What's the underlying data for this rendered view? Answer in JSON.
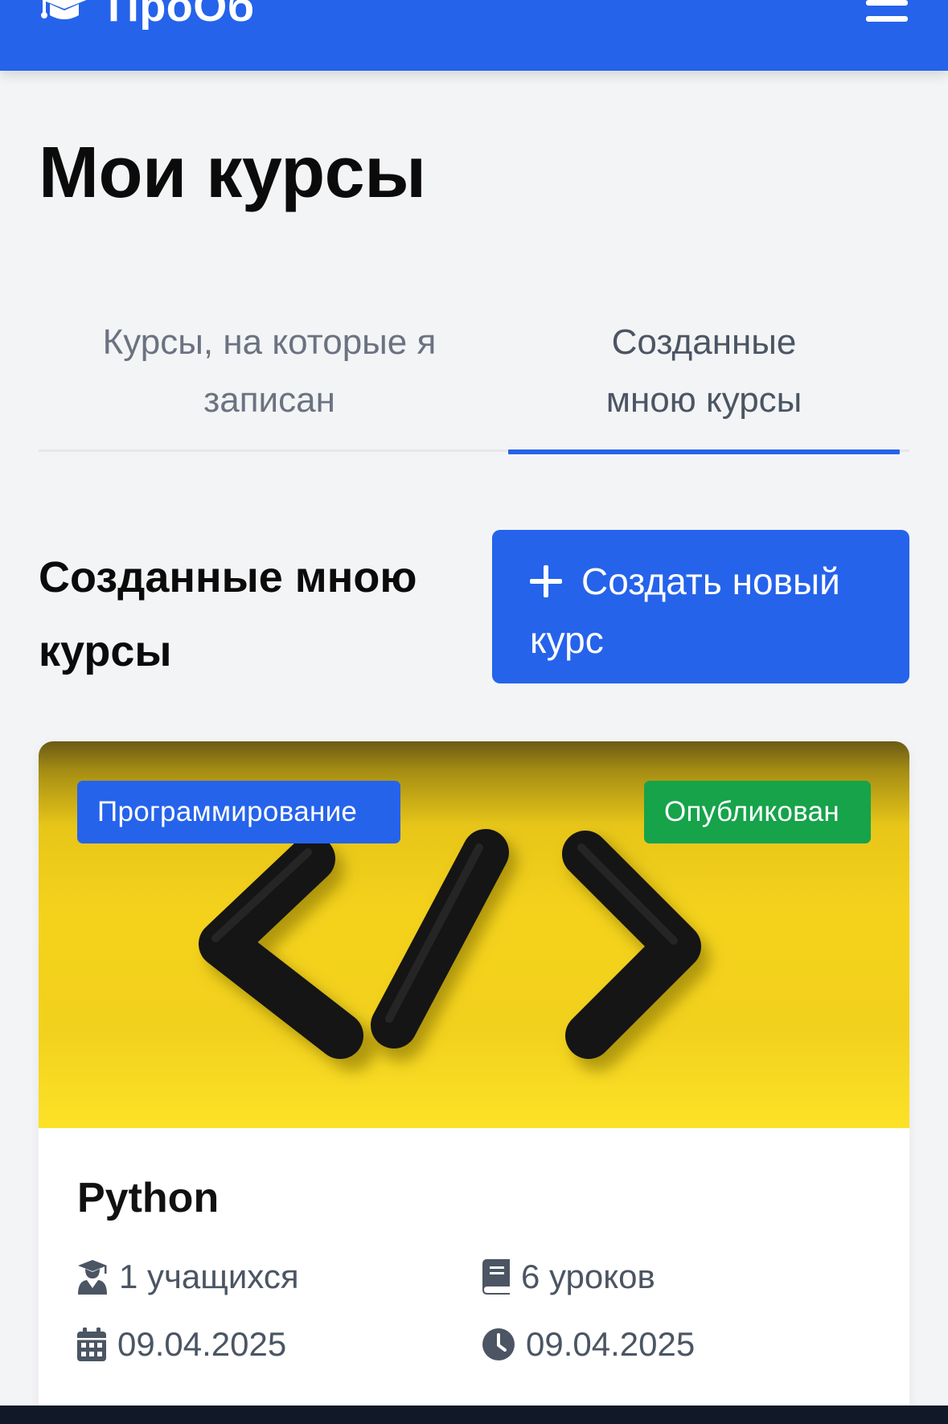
{
  "app": {
    "brand": "ПроОб",
    "primary_color": "#2563eb",
    "icons": {
      "logo": "graduation-cap-icon",
      "menu": "hamburger-icon"
    }
  },
  "page": {
    "title": "Мои курсы"
  },
  "tabs": [
    {
      "label": "Курсы, на которые я записан",
      "active": false
    },
    {
      "label": "Созданные мною курсы",
      "active": true
    }
  ],
  "section": {
    "title": "Созданные мною курсы",
    "create_button": {
      "label": "Создать новый курс",
      "icon": "plus-icon"
    }
  },
  "courses": [
    {
      "title": "Python",
      "category": "Программирование",
      "status": "Опубликован",
      "status_color": "#16a34a",
      "cover": "code-brackets-on-yellow",
      "students": "1 учащихся",
      "lessons": "6 уроков",
      "created": "09.04.2025",
      "updated": "09.04.2025"
    }
  ]
}
